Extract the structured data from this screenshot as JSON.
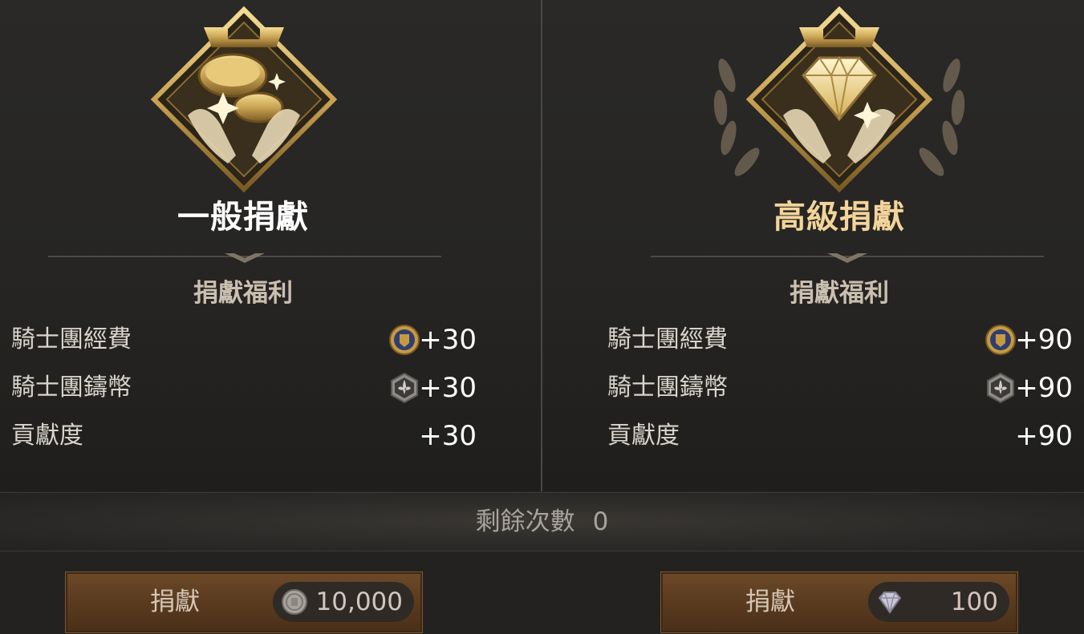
{
  "normal": {
    "title": "一般捐獻",
    "benefit_heading": "捐獻福利",
    "rows": [
      {
        "label": "騎士團經費",
        "icon": "knight-funds-icon",
        "value": "+30"
      },
      {
        "label": "騎士團鑄幣",
        "icon": "knight-coin-icon",
        "value": "+30"
      },
      {
        "label": "貢獻度",
        "icon": "",
        "value": "+30"
      }
    ],
    "button_label": "捐獻",
    "cost_icon": "silver-coin-icon",
    "cost": "10,000"
  },
  "advanced": {
    "title": "高級捐獻",
    "benefit_heading": "捐獻福利",
    "rows": [
      {
        "label": "騎士團經費",
        "icon": "knight-funds-icon",
        "value": "+90"
      },
      {
        "label": "騎士團鑄幣",
        "icon": "knight-coin-icon",
        "value": "+90"
      },
      {
        "label": "貢獻度",
        "icon": "",
        "value": "+90"
      }
    ],
    "button_label": "捐獻",
    "cost_icon": "diamond-icon",
    "cost": "100"
  },
  "remaining": {
    "label": "剩餘次數",
    "count": "0"
  },
  "colors": {
    "advanced_title": "#f3d49a",
    "button_brown": "#5b3c20",
    "gold": "#c9a85a"
  }
}
